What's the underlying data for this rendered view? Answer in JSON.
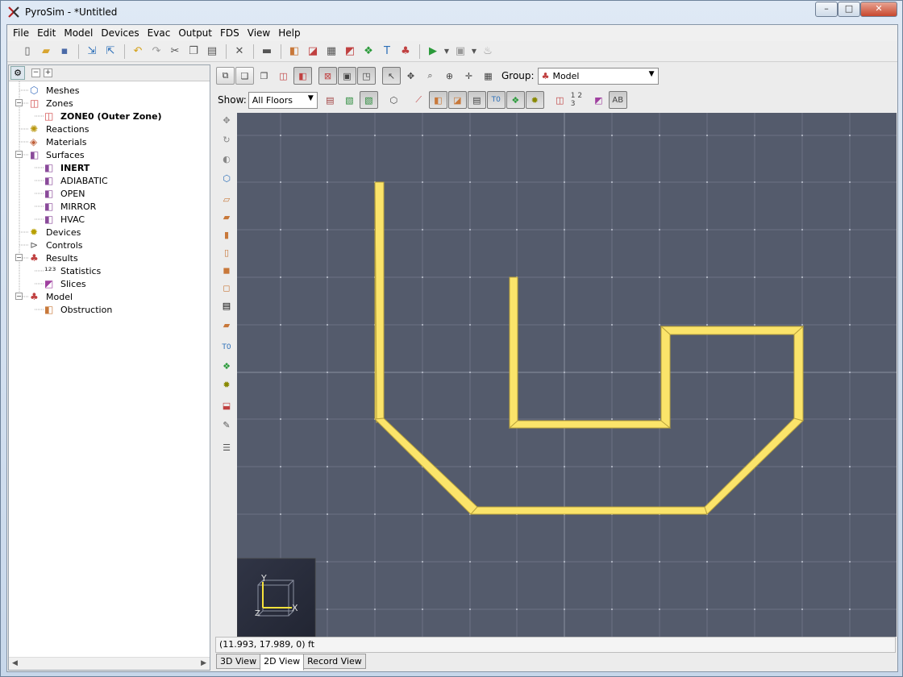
{
  "window": {
    "title": "PyroSim - *Untitled",
    "buttons": {
      "minimize": "–",
      "maximize": "□",
      "close": "✕"
    }
  },
  "menubar": [
    "File",
    "Edit",
    "Model",
    "Devices",
    "Evac",
    "Output",
    "FDS",
    "View",
    "Help"
  ],
  "tree": {
    "nodes": [
      {
        "label": "Meshes",
        "icon": "mesh-icon",
        "level": 0,
        "bold": false
      },
      {
        "label": "Zones",
        "icon": "zones-icon",
        "level": 0,
        "bold": false,
        "expanded": true
      },
      {
        "label": "ZONE0 (Outer Zone)",
        "icon": "zone-icon",
        "level": 1,
        "bold": true
      },
      {
        "label": "Reactions",
        "icon": "reaction-icon",
        "level": 0,
        "bold": false
      },
      {
        "label": "Materials",
        "icon": "materials-icon",
        "level": 0,
        "bold": false
      },
      {
        "label": "Surfaces",
        "icon": "surfaces-icon",
        "level": 0,
        "bold": false,
        "expanded": true
      },
      {
        "label": "INERT",
        "icon": "surface-icon",
        "level": 1,
        "bold": true
      },
      {
        "label": "ADIABATIC",
        "icon": "surface-icon",
        "level": 1,
        "bold": false
      },
      {
        "label": "OPEN",
        "icon": "surface-icon",
        "level": 1,
        "bold": false
      },
      {
        "label": "MIRROR",
        "icon": "surface-icon",
        "level": 1,
        "bold": false
      },
      {
        "label": "HVAC",
        "icon": "surface-icon",
        "level": 1,
        "bold": false
      },
      {
        "label": "Devices",
        "icon": "devices-icon",
        "level": 0,
        "bold": false
      },
      {
        "label": "Controls",
        "icon": "controls-icon",
        "level": 0,
        "bold": false
      },
      {
        "label": "Results",
        "icon": "results-icon",
        "level": 0,
        "bold": false,
        "expanded": true
      },
      {
        "label": "Statistics",
        "icon": "statistics-icon",
        "level": 1,
        "bold": false
      },
      {
        "label": "Slices",
        "icon": "slices-icon",
        "level": 1,
        "bold": false
      },
      {
        "label": "Model",
        "icon": "model-icon",
        "level": 0,
        "bold": false,
        "expanded": true
      },
      {
        "label": "Obstruction",
        "icon": "obstruction-icon",
        "level": 1,
        "bold": false
      }
    ]
  },
  "view_toolbar": {
    "group_label": "Group:",
    "group_value": "Model",
    "show_label": "Show:",
    "show_value": "All Floors",
    "label_t0": "T0",
    "label_123": "1 2 3",
    "label_ab": "AB"
  },
  "canvas": {
    "axis_y": "Y",
    "axis_x": "X",
    "axis_z": "Z",
    "colors": {
      "background": "#545b6c",
      "wall": "#fbe46a",
      "grid": "#6b7283"
    }
  },
  "status": {
    "coordinates": "(11.993, 17.989, 0) ft"
  },
  "view_tabs": [
    {
      "label": "3D View",
      "active": false
    },
    {
      "label": "2D View",
      "active": true
    },
    {
      "label": "Record View",
      "active": false
    }
  ]
}
